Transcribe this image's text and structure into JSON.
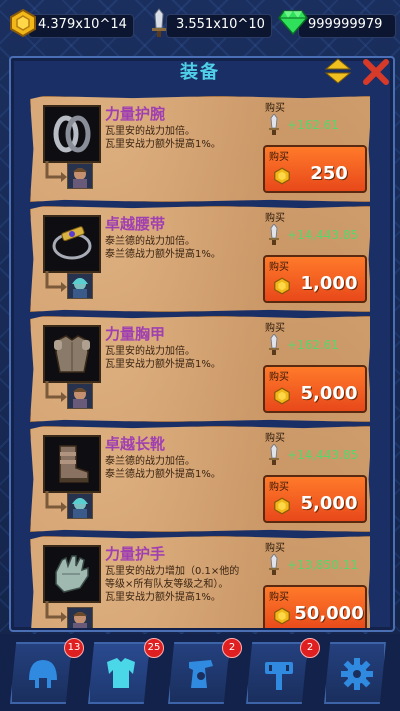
{
  "resources": {
    "gold": "4.379x10^14",
    "power": "3.551x10^10",
    "gems": "999999979"
  },
  "panel": {
    "title": "装备"
  },
  "items": [
    {
      "name": "力量护腕",
      "desc_line1": "瓦里安的战力加倍。",
      "desc_line2": "瓦里安战力额外提高1%。",
      "buy_hint": "购买",
      "stat": "+162.61",
      "buy_label": "购买",
      "price": "250",
      "icon": "bracer-icon",
      "hero": "varian"
    },
    {
      "name": "卓越腰带",
      "desc_line1": "泰兰德的战力加倍。",
      "desc_line2": "泰兰德战力额外提高1%。",
      "buy_hint": "购买",
      "stat": "+14,443.85",
      "buy_label": "购买",
      "price": "1,000",
      "icon": "belt-icon",
      "hero": "tyrande"
    },
    {
      "name": "力量胸甲",
      "desc_line1": "瓦里安的战力加倍。",
      "desc_line2": "瓦里安战力额外提高1%。",
      "buy_hint": "购买",
      "stat": "+162.61",
      "buy_label": "购买",
      "price": "5,000",
      "icon": "chestplate-icon",
      "hero": "varian"
    },
    {
      "name": "卓越长靴",
      "desc_line1": "泰兰德的战力加倍。",
      "desc_line2": "泰兰德战力额外提高1%。",
      "buy_hint": "购买",
      "stat": "+14,443.85",
      "buy_label": "购买",
      "price": "5,000",
      "icon": "boots-icon",
      "hero": "tyrande"
    },
    {
      "name": "力量护手",
      "desc_line1": "瓦里安的战力增加（0.1×他的",
      "desc_line2": "等级×所有队友等级之和）。",
      "desc_line3": "瓦里安战力额外提高1%。",
      "buy_hint": "购买",
      "stat": "+13,850.11",
      "buy_label": "购买",
      "price": "50,000",
      "icon": "gauntlet-icon",
      "hero": "varian"
    }
  ],
  "tabs": [
    {
      "name": "helmet-tab",
      "icon": "helmet-icon",
      "badge": "13"
    },
    {
      "name": "armor-tab",
      "icon": "armor-icon",
      "badge": "25"
    },
    {
      "name": "scroll-tab",
      "icon": "scroll-icon",
      "badge": "2"
    },
    {
      "name": "hammer-tab",
      "icon": "hammer-icon",
      "badge": "2"
    },
    {
      "name": "settings-tab",
      "icon": "gear-icon",
      "badge": ""
    }
  ],
  "colors": {
    "title": "#4fd0e8",
    "item_name": "#a040b0",
    "stat_green": "#57d76a",
    "buy_button": "#e8481a"
  }
}
